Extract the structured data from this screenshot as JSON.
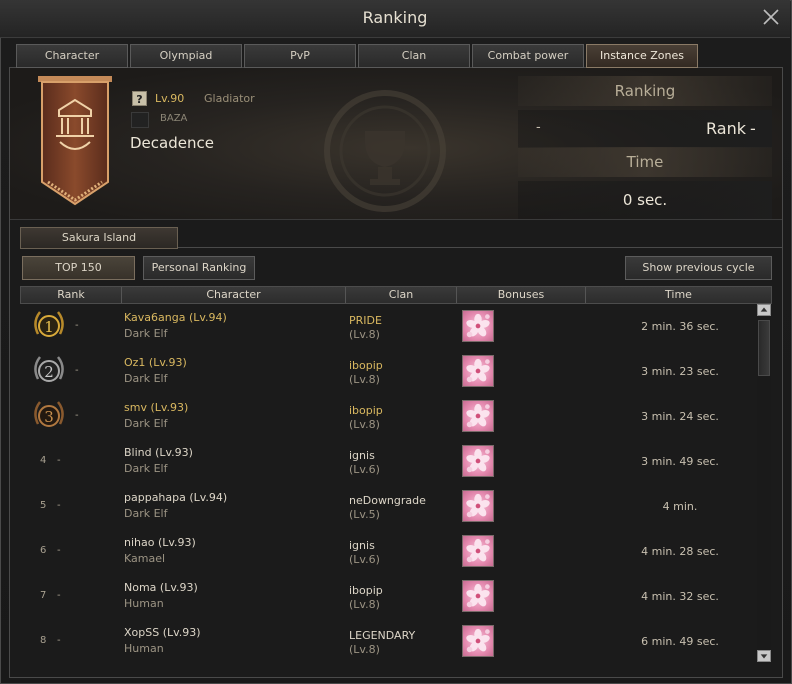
{
  "window": {
    "title": "Ranking"
  },
  "tabs": [
    "Character",
    "Olympiad",
    "PvP",
    "Clan",
    "Combat power",
    "Instance Zones"
  ],
  "active_tab": "Instance Zones",
  "player": {
    "level": "Lv.90",
    "class": "Gladiator",
    "clan": "BAZA",
    "name": "Decadence",
    "help": "?"
  },
  "stats": {
    "ranking_label": "Ranking",
    "rank_left": "-",
    "rank_label": "Rank",
    "rank_right": "-",
    "time_label": "Time",
    "time_value": "0 sec."
  },
  "zone_tab": "Sakura Island",
  "buttons": {
    "top": "TOP 150",
    "personal": "Personal Ranking",
    "previous": "Show previous cycle"
  },
  "columns": [
    "Rank",
    "Character",
    "Clan",
    "Bonuses",
    "Time"
  ],
  "rows": [
    {
      "rank": "1",
      "medal": "gold-medal-icon",
      "change": "-",
      "name": "Kava6anga (Lv.94)",
      "race": "Dark Elf",
      "clan": "PRIDE",
      "clan_level": "(Lv.8)",
      "time": "2 min. 36 sec."
    },
    {
      "rank": "2",
      "medal": "silver-medal-icon",
      "change": "-",
      "name": "Oz1 (Lv.93)",
      "race": "Dark Elf",
      "clan": "ibopip",
      "clan_level": "(Lv.8)",
      "time": "3 min. 23 sec."
    },
    {
      "rank": "3",
      "medal": "bronze-medal-icon",
      "change": "-",
      "name": "smv (Lv.93)",
      "race": "Dark Elf",
      "clan": "ibopip",
      "clan_level": "(Lv.8)",
      "time": "3 min. 24 sec."
    },
    {
      "rank": "4",
      "change": "-",
      "name": "Blind (Lv.93)",
      "race": "Dark Elf",
      "clan": "ignis",
      "clan_level": "(Lv.6)",
      "time": "3 min. 49 sec."
    },
    {
      "rank": "5",
      "change": "-",
      "name": "pappahapa (Lv.94)",
      "race": "Dark Elf",
      "clan": "neDowngrade",
      "clan_level": "(Lv.5)",
      "time": "4 min."
    },
    {
      "rank": "6",
      "change": "-",
      "name": "nihao (Lv.93)",
      "race": "Kamael",
      "clan": "ignis",
      "clan_level": "(Lv.6)",
      "time": "4 min. 28 sec."
    },
    {
      "rank": "7",
      "change": "-",
      "name": "Noma (Lv.93)",
      "race": "Human",
      "clan": "ibopip",
      "clan_level": "(Lv.8)",
      "time": "4 min. 32 sec."
    },
    {
      "rank": "8",
      "change": "-",
      "name": "XopSS (Lv.93)",
      "race": "Human",
      "clan": "LEGENDARY",
      "clan_level": "(Lv.8)",
      "time": "6 min. 49 sec."
    }
  ]
}
